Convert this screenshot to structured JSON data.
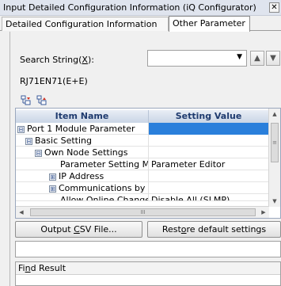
{
  "window": {
    "title": "Input Detailed Configuration Information (iQ Configurator)",
    "close_glyph": "✕"
  },
  "tabs": [
    {
      "label": "Detailed Configuration Information",
      "active": false
    },
    {
      "label": "Other Parameter",
      "active": true
    }
  ],
  "search": {
    "label_prefix": "Search String(",
    "label_accel": "X",
    "label_suffix": "):",
    "value": "",
    "dropdown_glyph": "▼",
    "up_glyph": "▲",
    "down_glyph": "▼"
  },
  "module_name": "RJ71EN71(E+E)",
  "toolbar": {
    "expand_icon": "expand-all-icon",
    "collapse_icon": "collapse-all-icon"
  },
  "grid": {
    "columns": [
      "Item Name",
      "Setting Value"
    ],
    "rows": [
      {
        "name": "Port 1 Module Parameter",
        "value": "",
        "expander": "⊟",
        "indent": 0,
        "selected": true
      },
      {
        "name": "Basic Setting",
        "value": "",
        "expander": "⊟",
        "indent": 1,
        "selected": false
      },
      {
        "name": "Own Node Settings",
        "value": "",
        "expander": "⊟",
        "indent": 2,
        "selected": false
      },
      {
        "name": "Parameter Setting Metl",
        "value": "Parameter Editor",
        "expander": "",
        "indent": 3,
        "selected": false
      },
      {
        "name": "IP Address",
        "value": "",
        "expander": "⊞",
        "indent": 3,
        "selected": false
      },
      {
        "name": "Communications by Net",
        "value": "",
        "expander": "⊞",
        "indent": 3,
        "selected": false
      },
      {
        "name": "Allow Online Change (SLMP)",
        "value": "Disable All (SLMP)",
        "expander": "",
        "indent": 3,
        "selected": false
      }
    ],
    "scroll_up_glyph": "▲",
    "scroll_down_glyph": "▼",
    "scroll_left_glyph": "◀",
    "scroll_right_glyph": "▶",
    "vthumb_grip": "≡",
    "hthumb_grip": "III"
  },
  "buttons": {
    "output_prefix": "Output ",
    "output_accel": "C",
    "output_suffix": "SV File...",
    "restore_prefix": "Rest",
    "restore_accel": "o",
    "restore_suffix": "re default settings"
  },
  "find_result": {
    "label_prefix": "Fi",
    "label_accel": "n",
    "label_suffix": "d Result"
  }
}
